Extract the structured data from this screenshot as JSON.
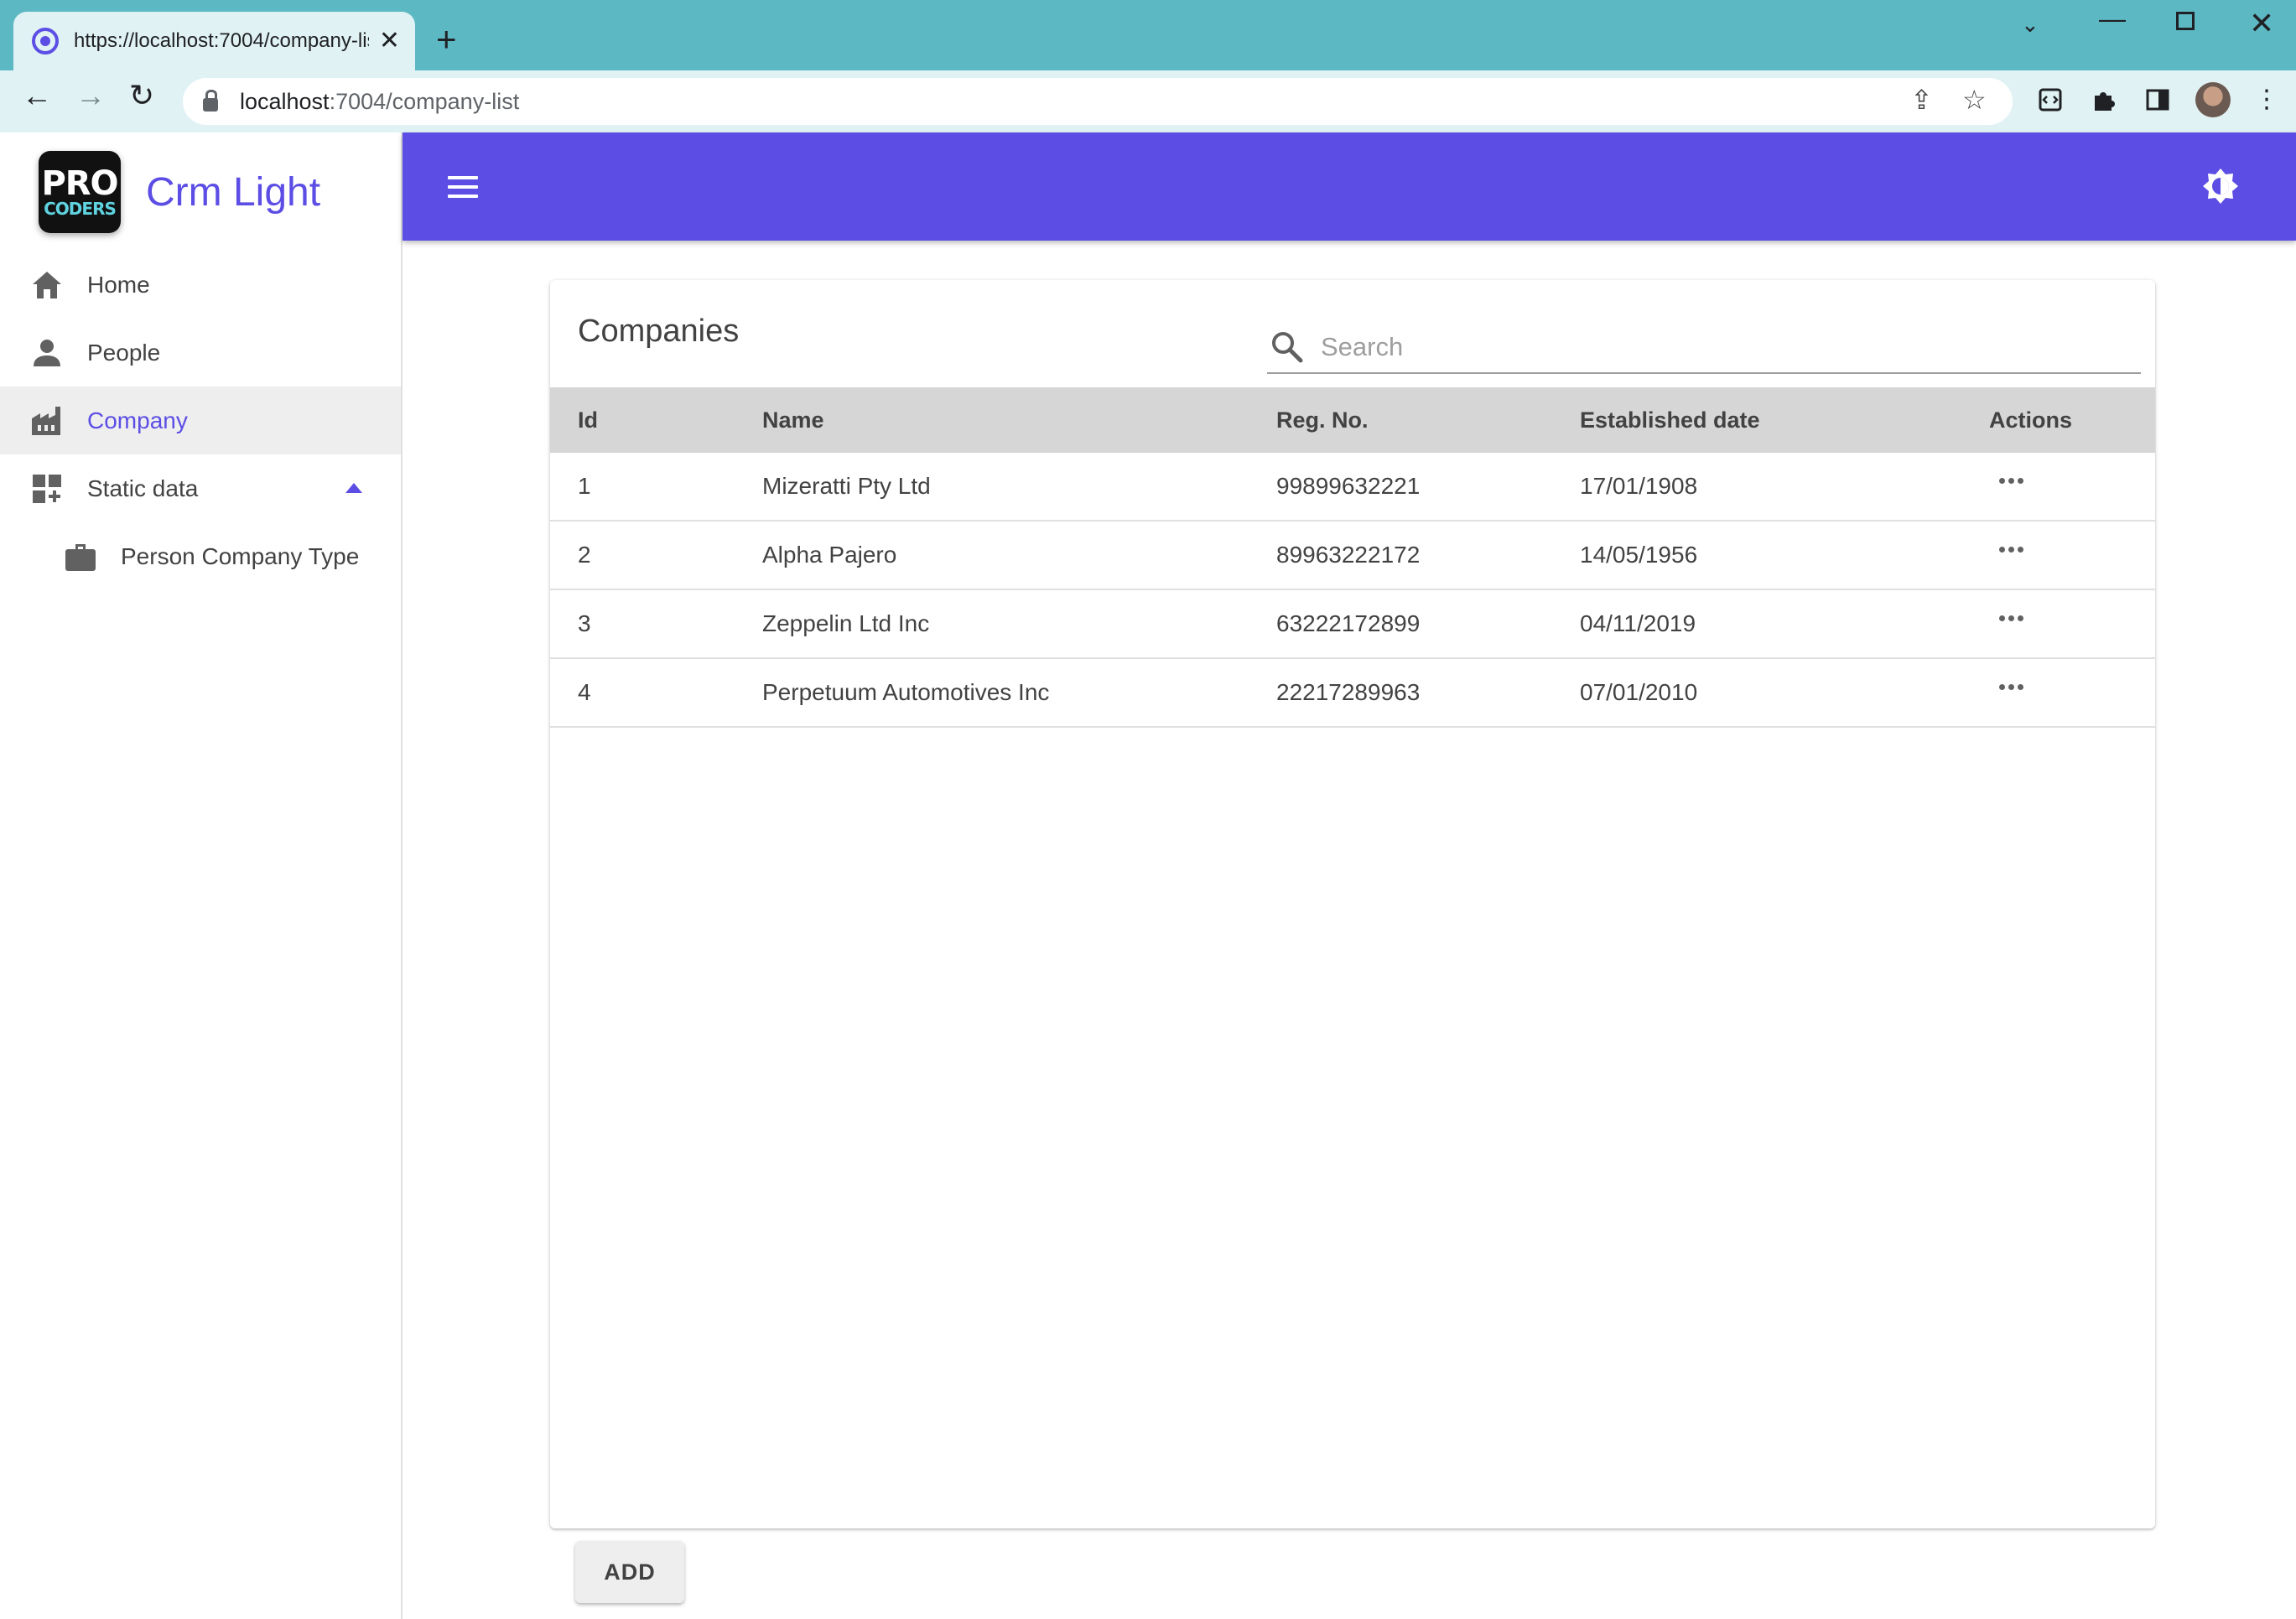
{
  "browser": {
    "tab_title": "https://localhost:7004/company-list",
    "url_host": "localhost",
    "url_rest": ":7004/company-list"
  },
  "app": {
    "brand_name": "Crm Light",
    "logo_top": "PRO",
    "logo_bottom": "CODERS",
    "accent_color": "#5c4ee5"
  },
  "sidebar": {
    "items": [
      {
        "label": "Home",
        "icon": "home-icon"
      },
      {
        "label": "People",
        "icon": "person-icon"
      },
      {
        "label": "Company",
        "icon": "factory-icon",
        "active": true
      },
      {
        "label": "Static data",
        "icon": "dashboard-add-icon",
        "expanded": true
      },
      {
        "label": "Person Company Type",
        "icon": "briefcase-icon"
      }
    ]
  },
  "main": {
    "title": "Companies",
    "search_placeholder": "Search",
    "columns": [
      "Id",
      "Name",
      "Reg. No.",
      "Established date",
      "Actions"
    ],
    "rows": [
      {
        "id": "1",
        "name": "Mizeratti Pty Ltd",
        "reg_no": "99899632221",
        "established": "17/01/1908"
      },
      {
        "id": "2",
        "name": "Alpha Pajero",
        "reg_no": "89963222172",
        "established": "14/05/1956"
      },
      {
        "id": "3",
        "name": "Zeppelin Ltd Inc",
        "reg_no": "63222172899",
        "established": "04/11/2019"
      },
      {
        "id": "4",
        "name": "Perpetuum Automotives Inc",
        "reg_no": "22217289963",
        "established": "07/01/2010"
      }
    ],
    "add_label": "ADD"
  }
}
